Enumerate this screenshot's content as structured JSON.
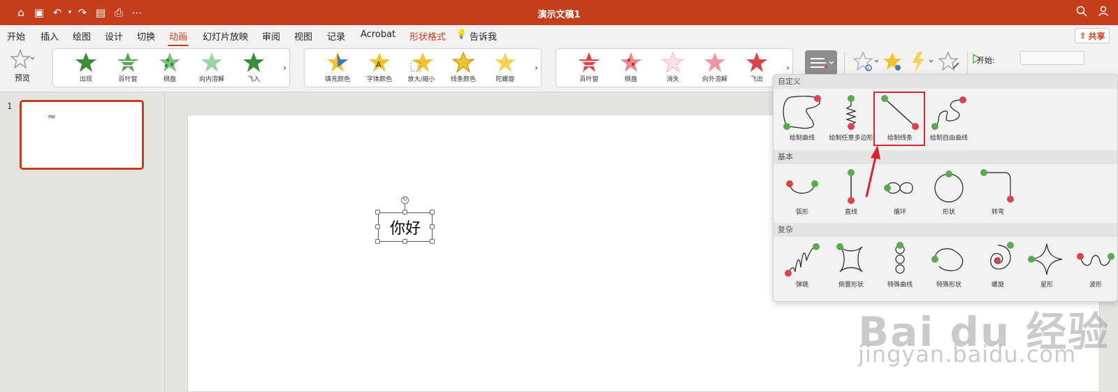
{
  "window": {
    "title": "演示文稿1",
    "quick_access": [
      "home-icon",
      "save-icon",
      "undo-icon",
      "undo-dropdown-icon",
      "redo-icon",
      "save-as-icon",
      "print-icon",
      "more-icon"
    ]
  },
  "ribbon_tabs": [
    "开始",
    "插入",
    "绘图",
    "设计",
    "切换",
    "动画",
    "幻灯片放映",
    "审阅",
    "视图",
    "记录",
    "Acrobat",
    "形状格式",
    "告诉我"
  ],
  "active_tab": "动画",
  "share_label": "共享",
  "ribbon": {
    "preview_label": "预览",
    "entrance_effects": [
      "出现",
      "百叶窗",
      "棋盘",
      "向内溶解",
      "飞入"
    ],
    "emphasis_effects": [
      "填充颜色",
      "字体颜色",
      "放大/缩小",
      "线条颜色",
      "陀螺旋"
    ],
    "exit_effects": [
      "百叶窗",
      "棋盘",
      "消失",
      "向外溶解",
      "飞出"
    ],
    "start_label": "开始:",
    "start_value": ""
  },
  "slides": {
    "number": "1",
    "thumb_text": "你好"
  },
  "slide_text": "你好",
  "motion_paths": {
    "custom": {
      "header": "自定义",
      "items": [
        "绘制曲线",
        "绘制任意多边形",
        "绘制线条",
        "绘制自由曲线"
      ],
      "selected": "绘制线条"
    },
    "basic": {
      "header": "基本",
      "items": [
        "弧形",
        "直线",
        "循环",
        "形状",
        "转弯"
      ]
    },
    "complex": {
      "header": "复杂",
      "items": [
        "弹跳",
        "倒置形状",
        "特殊曲线",
        "特殊形状",
        "螺旋",
        "星形",
        "波形"
      ]
    }
  },
  "colors": {
    "accent": "#c43e1c",
    "path_start": "#5aaa4e",
    "path_end": "#d9454a",
    "highlight": "#d9232d"
  },
  "watermark": {
    "logo": "Bai du 经验",
    "url": "jingyan.baidu.com"
  }
}
